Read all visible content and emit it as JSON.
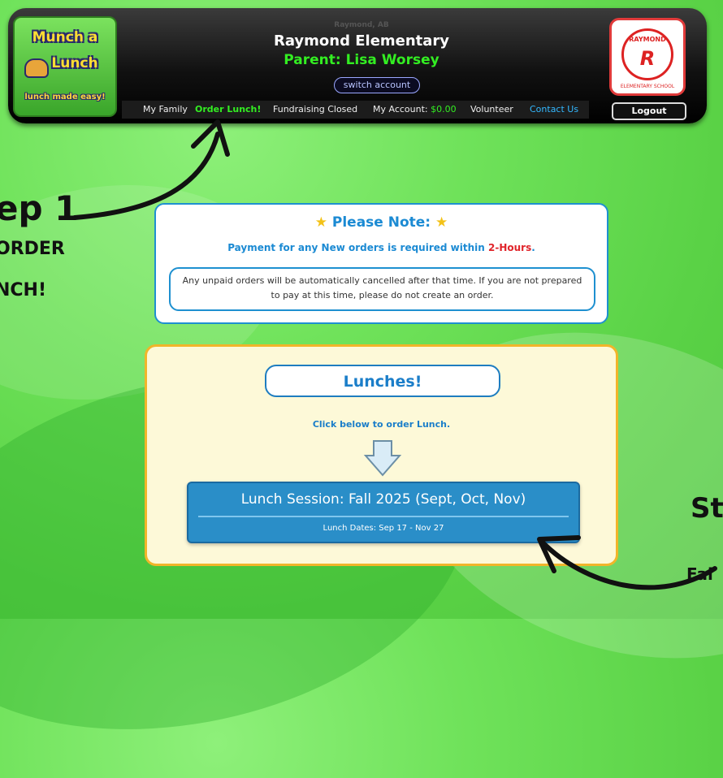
{
  "brand": {
    "line1": "Munch a",
    "line2": "Lunch",
    "tagline": "lunch made easy!"
  },
  "header": {
    "location": "Raymond, AB",
    "school": "Raymond Elementary",
    "parent": "Parent: Lisa Worsey",
    "switch_label": "switch account",
    "logout_label": "Logout",
    "badge": {
      "top": "RAYMOND",
      "letter": "R",
      "bottom": "ELEMENTARY SCHOOL"
    }
  },
  "nav": {
    "my_family": "My Family",
    "order_lunch": "Order Lunch!",
    "fundraising": "Fundraising Closed",
    "my_account": "My Account:",
    "my_account_value": "$0.00",
    "volunteer": "Volunteer",
    "contact": "Contact Us"
  },
  "annotations": {
    "step1": "ep 1",
    "order": "ORDER",
    "nch": "NCH!",
    "st": "St",
    "fal": "Fal"
  },
  "note": {
    "title": "Please Note:",
    "payment_prefix": "Payment for any New orders is required within ",
    "payment_highlight": "2-Hours",
    "payment_suffix": ".",
    "body": "Any unpaid orders will be automatically cancelled after that time. If you are not prepared to pay at this time, please do not create an order."
  },
  "lunches": {
    "title": "Lunches!",
    "instruction": "Click below to order Lunch.",
    "session_name": "Lunch Session: Fall 2025 (Sept, Oct, Nov)",
    "session_dates": "Lunch Dates: Sep 17 - Nov 27"
  },
  "colors": {
    "accent_blue": "#1b8ad3",
    "accent_green": "#33ee22",
    "warning_red": "#e0242a",
    "panel_yellow": "#fdf9d8"
  }
}
